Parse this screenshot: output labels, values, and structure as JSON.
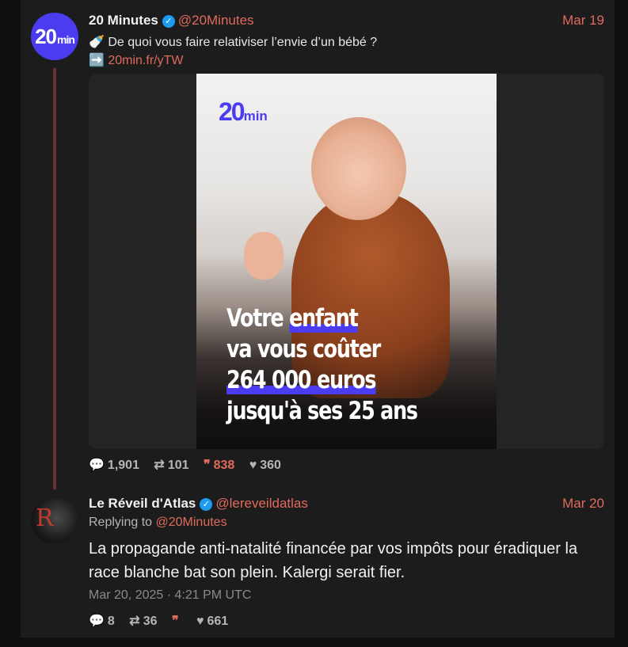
{
  "tweet1": {
    "name": "20 Minutes",
    "handle": "@20Minutes",
    "date": "Mar 19",
    "avatar_text": "20",
    "avatar_sub": "min",
    "line1_emoji": "🍼",
    "line1": "De quoi vous faire relativiser l’envie d’un bébé ?",
    "line2_emoji": "➡️",
    "link": "20min.fr/yTW",
    "media": {
      "logo_main": "20",
      "logo_sub": "min",
      "headline": [
        "Votre",
        "enfant",
        "va vous coûter",
        "264 000 euros",
        "jusqu'à ses 25 ans"
      ]
    },
    "stats": {
      "replies": "1,901",
      "retweets": "101",
      "quotes": "838",
      "likes": "360"
    }
  },
  "tweet2": {
    "name": "Le Réveil d'Atlas",
    "handle": "@lereveildatlas",
    "date": "Mar 20",
    "avatar_mark": "R",
    "replying_label": "Replying to",
    "replying_handle": "@20Minutes",
    "text": "La propagande anti-natalité financée par vos impôts pour éradiquer la race blanche bat son plein. Kalergi serait fier.",
    "timestamp": "Mar 20, 2025 · 4:21 PM UTC",
    "stats": {
      "replies": "8",
      "retweets": "36",
      "quotes": "",
      "likes": "661"
    }
  },
  "colors": {
    "accent": "#e06a5c",
    "brand": "#4b3cf0",
    "verified": "#1d9bf0",
    "thread": "#6b2f2f"
  },
  "icons": {
    "reply": "speech-bubble-icon",
    "retweet": "retweet-icon",
    "quote": "quote-icon",
    "like": "heart-icon",
    "verified": "verified-badge-icon"
  }
}
